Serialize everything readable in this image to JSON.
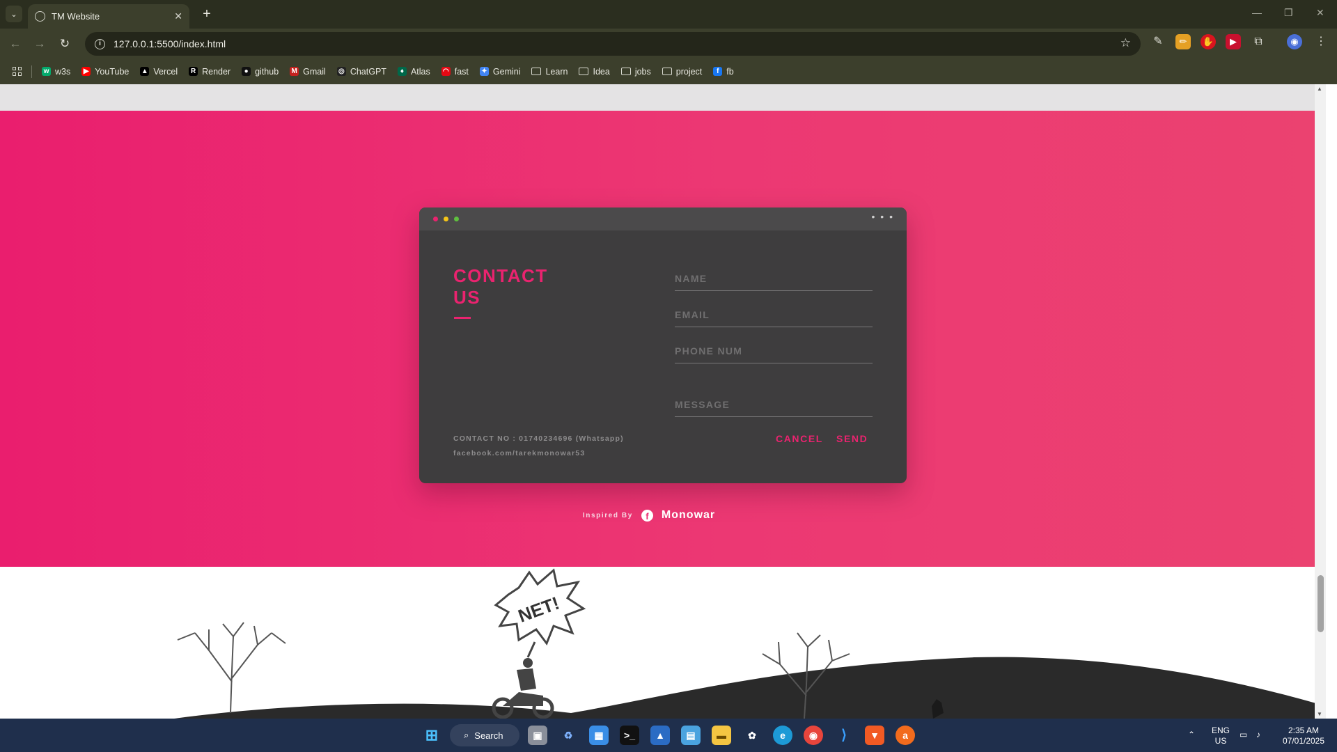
{
  "browser": {
    "tab_title": "TM Website",
    "url": "127.0.0.1:5500/index.html",
    "bookmarks": [
      {
        "label": "w3s",
        "icon": "w3schools-icon",
        "color": "#04aa6d",
        "glyph": "w"
      },
      {
        "label": "YouTube",
        "icon": "youtube-icon",
        "color": "#ff0000",
        "glyph": "▶"
      },
      {
        "label": "Vercel",
        "icon": "vercel-icon",
        "color": "#000000",
        "glyph": "▲"
      },
      {
        "label": "Render",
        "icon": "render-icon",
        "color": "#000000",
        "glyph": "R"
      },
      {
        "label": "github",
        "icon": "github-icon",
        "color": "#111111",
        "glyph": "●"
      },
      {
        "label": "Gmail",
        "icon": "gmail-icon",
        "color": "#c5221f",
        "glyph": "M"
      },
      {
        "label": "ChatGPT",
        "icon": "chatgpt-icon",
        "color": "#222222",
        "glyph": "◎"
      },
      {
        "label": "Atlas",
        "icon": "mongodb-atlas-icon",
        "color": "#00684a",
        "glyph": "♦"
      },
      {
        "label": "fast",
        "icon": "fast-speedtest-icon",
        "color": "#e50914",
        "glyph": "◠"
      },
      {
        "label": "Gemini",
        "icon": "gemini-icon",
        "color": "#4285f4",
        "glyph": "✦"
      },
      {
        "label": "Learn",
        "icon": "folder-icon",
        "folder": true
      },
      {
        "label": "Idea",
        "icon": "folder-icon",
        "folder": true
      },
      {
        "label": "jobs",
        "icon": "folder-icon",
        "folder": true
      },
      {
        "label": "project",
        "icon": "folder-icon",
        "folder": true
      },
      {
        "label": "fb",
        "icon": "facebook-icon",
        "color": "#1877f2",
        "glyph": "f"
      }
    ]
  },
  "contact_card": {
    "title_line1": "CONTACT",
    "title_line2": "US",
    "contact_no": "CONTACT NO : 01740234696 (Whatsapp)",
    "facebook": "facebook.com/tarekmonowar53",
    "fields": {
      "name_placeholder": "NAME",
      "email_placeholder": "EMAIL",
      "phone_placeholder": "PHONE NUM",
      "message_placeholder": "MESSAGE"
    },
    "cancel_label": "CANCEL",
    "send_label": "SEND",
    "dot_colors": [
      "#ea236f",
      "#f5c518",
      "#5fbf3f"
    ]
  },
  "footer": {
    "inspired_label": "Inspired By",
    "author": "Monowar"
  },
  "scene": {
    "sign_text": "NET!"
  },
  "colors": {
    "accent": "#ea236f",
    "pink_bg": "#ec3873",
    "card_bg": "#3e3d3e"
  },
  "taskbar": {
    "search_label": "Search",
    "lang_line1": "ENG",
    "lang_line2": "US",
    "time": "2:35 AM",
    "date": "07/01/2025"
  }
}
